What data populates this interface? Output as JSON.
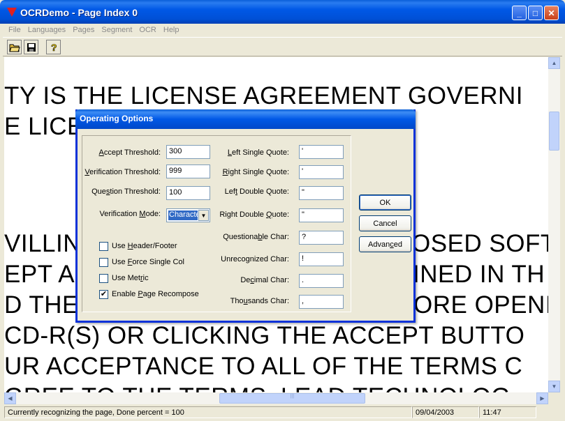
{
  "window": {
    "title": "OCRDemo - Page Index 0",
    "minimize_glyph": "_",
    "maximize_glyph": "□",
    "close_glyph": "✕"
  },
  "menu": [
    "File",
    "Languages",
    "Pages",
    "Segment",
    "OCR",
    "Help"
  ],
  "toolbar": {
    "icons": [
      "open-folder-icon",
      "save-disk-icon",
      "help-icon"
    ]
  },
  "document": {
    "lines": [
      "TY IS THE LICENSE AGREEMENT GOVERNI",
      "E LICE",
      "VILLIN",
      "OSED SOFT",
      "EPT A",
      "INED IN TH",
      "D THE",
      "ORE OPENI",
      "CD-R(S) OR CLICKING THE ACCEPT BUTTO",
      "UR ACCEPTANCE TO ALL OF THE TERMS C",
      "GREE TO THE TERMS, LEAD TECHNOLOG"
    ]
  },
  "dialog": {
    "title": "Operating Options",
    "left_fields": [
      {
        "label_pre": "",
        "label_key": "A",
        "label_post": "ccept Threshold:",
        "value": "300"
      },
      {
        "label_pre": "",
        "label_key": "V",
        "label_post": "erification Threshold:",
        "value": "999"
      },
      {
        "label_pre": "Que",
        "label_key": "s",
        "label_post": "tion Threshold:",
        "value": "100"
      }
    ],
    "mode": {
      "label_pre": "Verification ",
      "label_key": "M",
      "label_post": "ode:",
      "value": "Character"
    },
    "checkboxes": [
      {
        "label_pre": "Use ",
        "label_key": "H",
        "label_post": "eader/Footer",
        "checked": false
      },
      {
        "label_pre": "Use ",
        "label_key": "F",
        "label_post": "orce Single Col",
        "checked": false
      },
      {
        "label_pre": "Use Met",
        "label_key": "r",
        "label_post": "ic",
        "checked": false
      },
      {
        "label_pre": "Enable ",
        "label_key": "P",
        "label_post": "age Recompose",
        "checked": true
      }
    ],
    "right_fields": [
      {
        "label_pre": "",
        "label_key": "L",
        "label_post": "eft Single Quote:",
        "value": "'"
      },
      {
        "label_pre": "",
        "label_key": "R",
        "label_post": "ight Single Quote:",
        "value": "'"
      },
      {
        "label_pre": "Lef",
        "label_key": "t",
        "label_post": " Double Quote:",
        "value": "\""
      },
      {
        "label_pre": "Right Double ",
        "label_key": "Q",
        "label_post": "uote:",
        "value": "\""
      },
      {
        "label_pre": "Questiona",
        "label_key": "b",
        "label_post": "le Char:",
        "value": "?"
      },
      {
        "label_pre": "Unrecognized Char:",
        "label_key": "",
        "label_post": "",
        "value": "!"
      },
      {
        "label_pre": "De",
        "label_key": "c",
        "label_post": "imal Char:",
        "value": "."
      },
      {
        "label_pre": "Tho",
        "label_key": "u",
        "label_post": "sands Char:",
        "value": ","
      }
    ],
    "buttons": {
      "ok": "OK",
      "cancel": "Cancel",
      "advanced_pre": "Advan",
      "advanced_key": "c",
      "advanced_post": "ed"
    }
  },
  "status": {
    "message": "Currently recognizing the page, Done percent =  100",
    "date": "09/04/2003",
    "time": "11:47"
  }
}
